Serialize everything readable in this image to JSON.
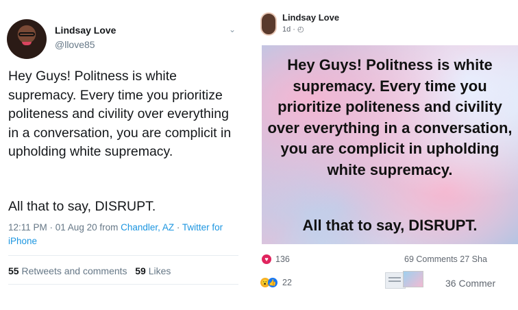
{
  "tweet": {
    "name": "Lindsay Love",
    "handle": "@llove85",
    "body": "Hey Guys! Politness is white supremacy. Every time you prioritize politeness and civility over everything in a conversation, you are complicit in upholding white supremacy.",
    "disrupt": "All that to say, DISRUPT.",
    "meta_prefix": "12:11 PM · 01 Aug 20 from ",
    "meta_location": "Chandler, AZ",
    "meta_sep": " · ",
    "meta_source": "Twitter for iPhone",
    "retweets_count": "55",
    "retweets_label": "Retweets and comments",
    "likes_count": "59",
    "likes_label": "Likes"
  },
  "facebook": {
    "name": "Lindsay Love",
    "time": "1d · ",
    "image_text": "Hey Guys! Politness is white supremacy. Every time you prioritize politeness and civility over everything in a conversation, you are complicit in upholding white supremacy.",
    "image_disrupt": "All that to say, DISRUPT.",
    "reactions": "136",
    "comments_shares": "69 Comments  27 Sha",
    "reactions2": "22",
    "comments2": "36 Commer"
  }
}
